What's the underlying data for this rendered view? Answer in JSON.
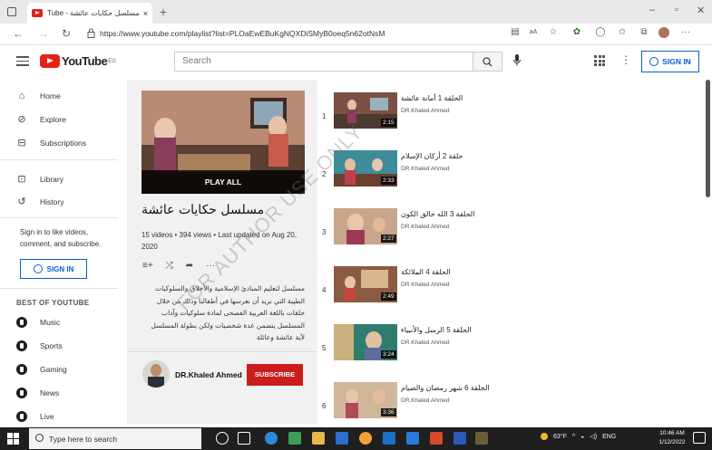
{
  "browser": {
    "tab_title": "مسلسل حكايات عائشة - YouTube",
    "tab_close": "×",
    "new_tab": "+",
    "url": "https://www.youtube.com/playlist?list=PLOaEwEBuKgNQXDiSMyB0oeq5n62otNsM"
  },
  "header": {
    "logo_text": "YouTube",
    "logo_sup": "EG",
    "search_placeholder": "Search",
    "signin_label": "SIGN IN"
  },
  "sidebar": {
    "primary": [
      {
        "label": "Home",
        "icon": "home-icon"
      },
      {
        "label": "Explore",
        "icon": "compass-icon"
      },
      {
        "label": "Subscriptions",
        "icon": "subscriptions-icon"
      }
    ],
    "secondary": [
      {
        "label": "Library",
        "icon": "library-icon"
      },
      {
        "label": "History",
        "icon": "history-icon"
      }
    ],
    "signin_prompt": "Sign in to like videos, comment, and subscribe.",
    "signin_label": "SIGN IN",
    "best_of_heading": "BEST OF YOUTUBE",
    "best_of": [
      {
        "label": "Music"
      },
      {
        "label": "Sports"
      },
      {
        "label": "Gaming"
      },
      {
        "label": "News"
      },
      {
        "label": "Live"
      }
    ]
  },
  "playlist": {
    "play_all": "PLAY ALL",
    "title": "مسلسل حكايات عائشة",
    "meta": "15 videos • 394 views • Last updated on Aug 20, 2020",
    "description": "مسلسل لتعليم المبادئ الإسلامية والأخلاق والسلوكيات الطيبة التي نريد أن نغرسها في أطفالنا وذلك من خلال حلقات باللغة العربية الفصحى لمادة سلوكيات وآداب المسلسل يتضمن عدة شخصيات ولكن بطولة المسلسل لآية عائشة وعائلة",
    "owner": "DR.Khaled Ahmed",
    "subscribe_label": "SUBSCRIBE"
  },
  "videos": [
    {
      "index": "1",
      "title": "الحلقة 1 أمانة عائشة",
      "channel": "DR.Khaled Ahmed",
      "duration": "2:15"
    },
    {
      "index": "2",
      "title": "حلقة 2 أركان الإسلام",
      "channel": "DR.Khaled Ahmed",
      "duration": "2:33"
    },
    {
      "index": "3",
      "title": "الحلقة 3 الله خالق الكون",
      "channel": "DR.Khaled Ahmed",
      "duration": "2:27"
    },
    {
      "index": "4",
      "title": "الحلقة 4 الملائكة",
      "channel": "DR.Khaled Ahmed",
      "duration": "2:49"
    },
    {
      "index": "5",
      "title": "الحلقة 5 الرسل والأنبياء",
      "channel": "DR.Khaled Ahmed",
      "duration": "3:24"
    },
    {
      "index": "6",
      "title": "الحلقة 6 شهر رمضان والصيام",
      "channel": "DR.Khaled Ahmed",
      "duration": "3:36"
    }
  ],
  "taskbar": {
    "search_placeholder": "Type here to search",
    "temperature": "63°F",
    "language": "ENG",
    "time": "10:46 AM",
    "date": "1/12/2022"
  },
  "watermark": "FOR AUTHOR USE ONLY",
  "colors": {
    "youtube_red": "#e62117",
    "signin_blue": "#065fd4",
    "subscribe_red": "#cc1d1d",
    "taskbar": "#1f1f1f"
  }
}
